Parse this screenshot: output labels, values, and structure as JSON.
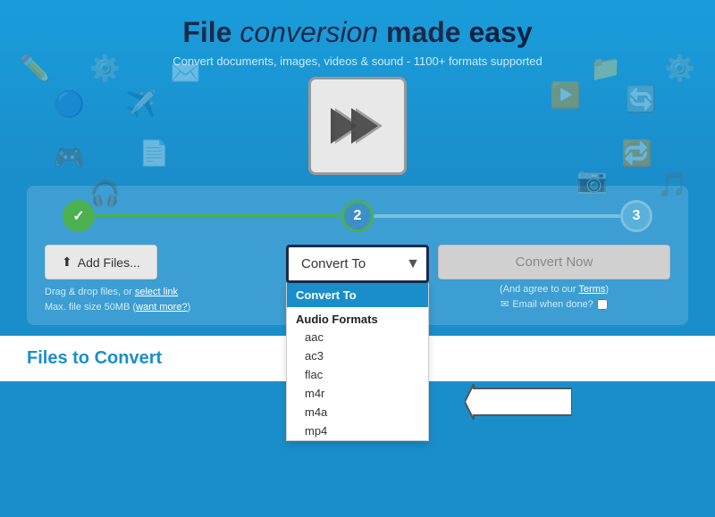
{
  "hero": {
    "title_normal": "File ",
    "title_highlight1": "conversion",
    "title_middle": " made ",
    "title_highlight2": "easy",
    "subtitle": "Convert documents, images, videos & sound - 1100+ formats supported"
  },
  "steps": [
    {
      "id": 1,
      "label": "✓",
      "state": "done"
    },
    {
      "id": 2,
      "label": "2",
      "state": "active"
    },
    {
      "id": 3,
      "label": "3",
      "state": "inactive"
    }
  ],
  "buttons": {
    "add_files": "Add Files...",
    "convert_now": "Convert Now",
    "convert_select_label": "Convert To"
  },
  "file_note": {
    "drag_text": "Drag & drop files, or ",
    "select_link": "select link",
    "max_text": "Max. file size 50MB (",
    "want_more_link": "want more?",
    "end": ")"
  },
  "convert_note": {
    "agree_text": "(And agree to our ",
    "terms_link": "Terms",
    "end": ")"
  },
  "email_label": "Email when done?",
  "dropdown": {
    "header": "Convert To",
    "groups": [
      {
        "label": "Audio Formats",
        "items": [
          "aac",
          "ac3",
          "flac",
          "m4r",
          "m4a",
          "mp4"
        ]
      }
    ]
  },
  "files_section": {
    "title_normal": "Files to ",
    "title_highlight": "Convert"
  }
}
